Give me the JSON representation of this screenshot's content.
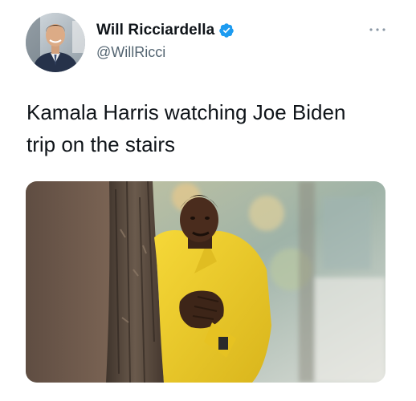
{
  "tweet": {
    "author": {
      "display_name": "Will Ricciardella",
      "handle": "@WillRicci",
      "verified": true
    },
    "text_lines": [
      "Kamala Harris watching Joe Biden",
      "trip on the stairs"
    ],
    "menu_icon": "more-horizontal-icon",
    "media": {
      "kind": "photo",
      "depicts": "man in yellow suit peeking from behind a tree trunk, rubbing hands"
    }
  },
  "colors": {
    "text_primary": "#0f1419",
    "text_secondary": "#536471",
    "verified_blue": "#1d9bf0",
    "suit_yellow": "#f2cf2a"
  }
}
